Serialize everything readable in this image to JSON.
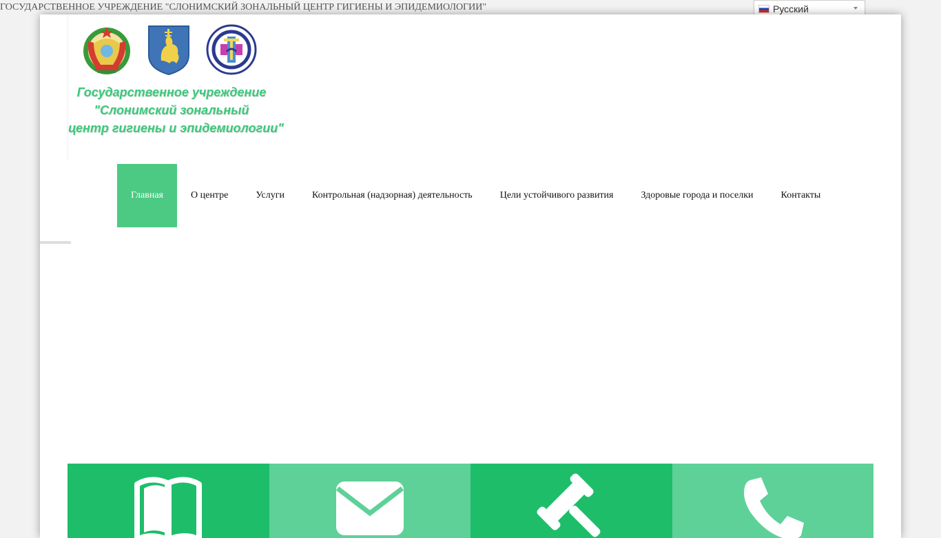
{
  "header": {
    "site_title": "ГОСУДАРСТВЕННОЕ УЧРЕЖДЕНИЕ \"СЛОНИМСКИЙ ЗОНАЛЬНЫЙ ЦЕНТР ГИГИЕНЫ И ЭПИДЕМИОЛОГИИ\"",
    "language": {
      "selected": "Русский",
      "flag_icon": "russia-flag-icon"
    }
  },
  "logo": {
    "lines": [
      "Государственное учреждение",
      "\"Слонимский зональный",
      "центр гигиены и эпидемиологии\""
    ],
    "text_color": "#3cc87a"
  },
  "nav": {
    "items": [
      {
        "label": "Главная",
        "active": true
      },
      {
        "label": "О центре",
        "active": false
      },
      {
        "label": "Услуги",
        "active": false
      },
      {
        "label": "Контрольная (надзорная) деятельность",
        "active": false
      },
      {
        "label": "Цели устойчивого развития",
        "active": false
      },
      {
        "label": "Здоровые города и поселки",
        "active": false
      },
      {
        "label": "Контакты",
        "active": false
      }
    ],
    "active_color": "#4cc983"
  },
  "tiles": [
    {
      "icon": "book-icon",
      "color": "#1ebd6a"
    },
    {
      "icon": "envelope-icon",
      "color": "#5ed198"
    },
    {
      "icon": "gavel-icon",
      "color": "#1ebd6a"
    },
    {
      "icon": "phone-icon",
      "color": "#5ed198"
    }
  ]
}
